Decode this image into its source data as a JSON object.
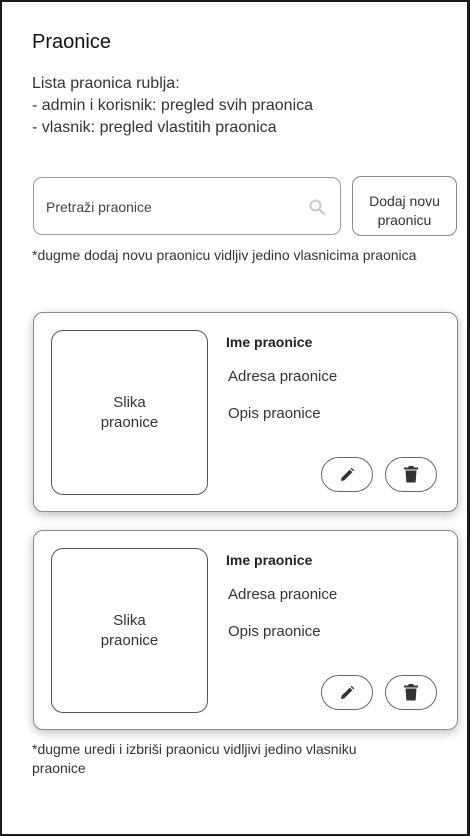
{
  "header": {
    "title": "Praonice",
    "description_lines": [
      "Lista praonica rublja:",
      "- admin i korisnik: pregled svih praonica",
      "- vlasnik: pregled vlastitih praonica"
    ]
  },
  "search": {
    "placeholder": "Pretraži praonice",
    "icon": "search-icon"
  },
  "add_button": {
    "line1": "Dodaj novu",
    "line2": "praonicu"
  },
  "note_add": "*dugme dodaj novu praonicu vidljiv jedino vlasnicima praonica",
  "cards": [
    {
      "image_line1": "Slika",
      "image_line2": "praonice",
      "name": "Ime praonice",
      "address": "Adresa praonice",
      "description": "Opis praonice",
      "edit_icon": "pencil-icon",
      "delete_icon": "trash-icon"
    },
    {
      "image_line1": "Slika",
      "image_line2": "praonice",
      "name": "Ime praonice",
      "address": "Adresa praonice",
      "description": "Opis praonice",
      "edit_icon": "pencil-icon",
      "delete_icon": "trash-icon"
    }
  ],
  "note_edit": "*dugme uredi i izbriši praonicu vidljivi jedino vlasniku praonice"
}
